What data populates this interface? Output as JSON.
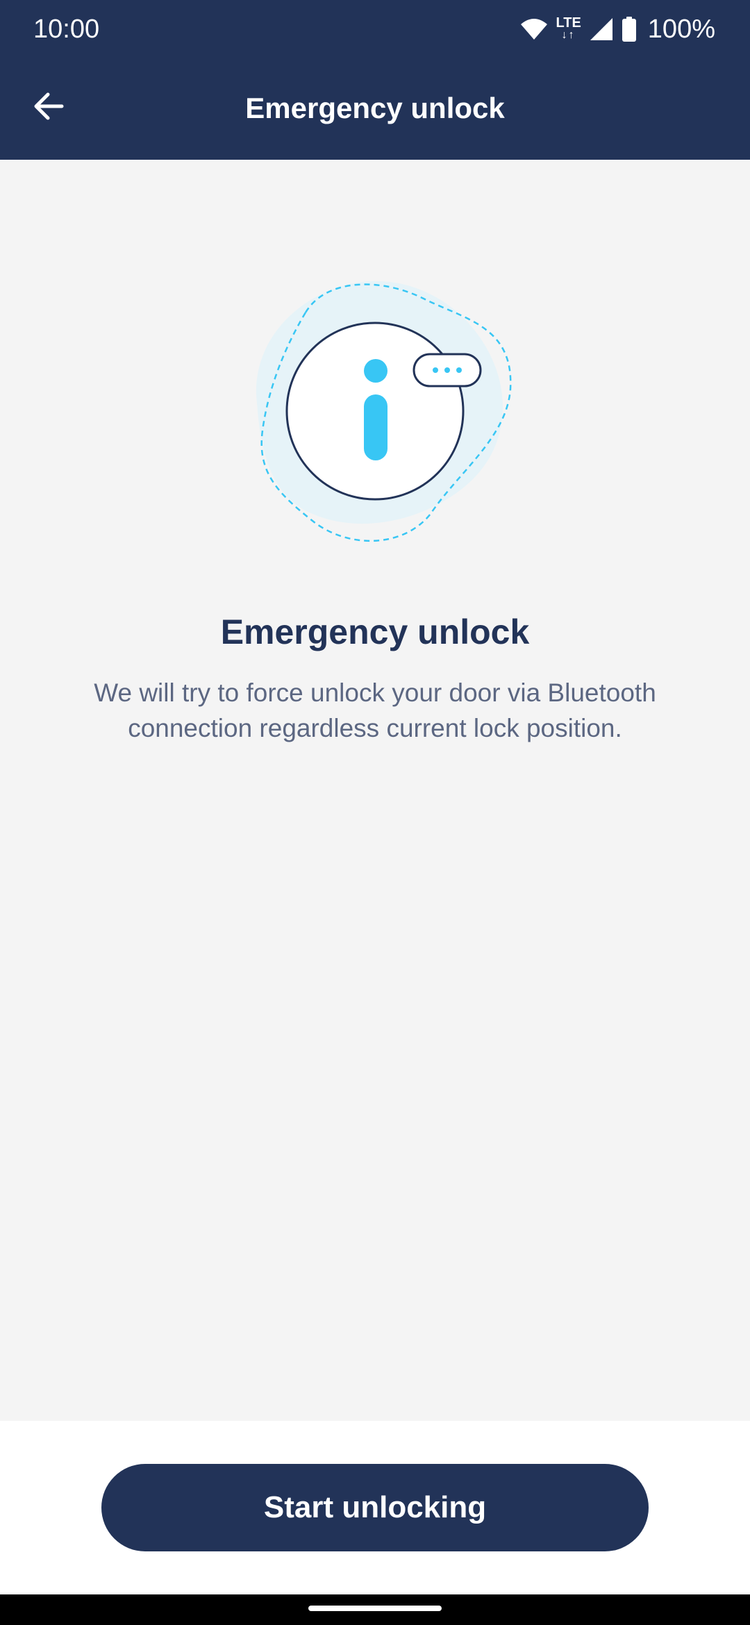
{
  "status_bar": {
    "time": "10:00",
    "network": "LTE",
    "battery": "100%",
    "icons": [
      "wifi-icon",
      "lte-icon",
      "signal-icon",
      "battery-icon"
    ]
  },
  "app_bar": {
    "title": "Emergency unlock",
    "back_icon": "arrow-left-icon"
  },
  "content": {
    "title": "Emergency unlock",
    "description": "We will try to force unlock your door via Bluetooth connection regardless current lock position.",
    "illustration_icon": "info-icon"
  },
  "actions": {
    "start_label": "Start unlocking"
  },
  "colors": {
    "primary": "#223358",
    "accent": "#38c6f4",
    "background": "#f4f4f4",
    "text_secondary": "#5c6782"
  }
}
